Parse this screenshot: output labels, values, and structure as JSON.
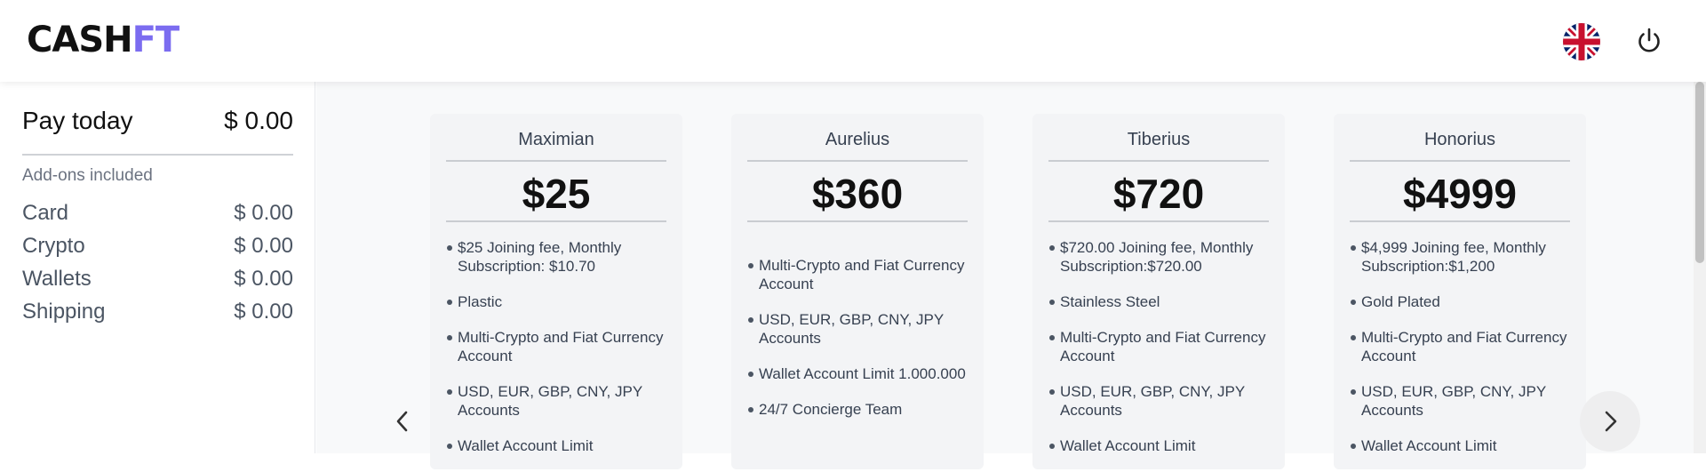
{
  "header": {
    "logo_part1": "CASH",
    "logo_part2": "FT",
    "language_icon": "uk-flag-icon",
    "logout_icon": "power-icon"
  },
  "sidebar": {
    "pay_today_label": "Pay today",
    "pay_today_value": "$ 0.00",
    "addons_title": "Add-ons included",
    "addons": [
      {
        "label": "Card",
        "value": "$ 0.00"
      },
      {
        "label": "Crypto",
        "value": "$ 0.00"
      },
      {
        "label": "Wallets",
        "value": "$ 0.00"
      },
      {
        "label": "Shipping",
        "value": "$ 0.00"
      }
    ]
  },
  "plans": [
    {
      "name": "Maximian",
      "price": "$25",
      "features": [
        "$25 Joining fee, Monthly Subscription: $10.70",
        "Plastic",
        "Multi-Crypto and Fiat Currency Account",
        "USD, EUR, GBP, CNY, JPY Accounts",
        "Wallet Account Limit"
      ]
    },
    {
      "name": "Aurelius",
      "price": "$360",
      "features": [
        "Multi-Crypto and Fiat Currency Account",
        "USD, EUR, GBP, CNY, JPY Accounts",
        "Wallet Account Limit 1.000.000",
        "24/7 Concierge Team"
      ]
    },
    {
      "name": "Tiberius",
      "price": "$720",
      "features": [
        "$720.00 Joining fee, Monthly Subscription:$720.00",
        "Stainless Steel",
        "Multi-Crypto and Fiat Currency Account",
        "USD, EUR, GBP, CNY, JPY Accounts",
        "Wallet Account Limit"
      ]
    },
    {
      "name": "Honorius",
      "price": "$4999",
      "features": [
        "$4,999 Joining fee, Monthly Subscription:$1,200",
        "Gold Plated",
        "Multi-Crypto and Fiat Currency Account",
        "USD, EUR, GBP, CNY, JPY Accounts",
        "Wallet Account Limit"
      ]
    }
  ],
  "carousel": {
    "prev_icon": "chevron-left-icon",
    "next_icon": "chevron-right-icon"
  },
  "colors": {
    "brand_accent": "#7b6cf0",
    "text_dark": "#111111",
    "muted": "#6b7280"
  }
}
